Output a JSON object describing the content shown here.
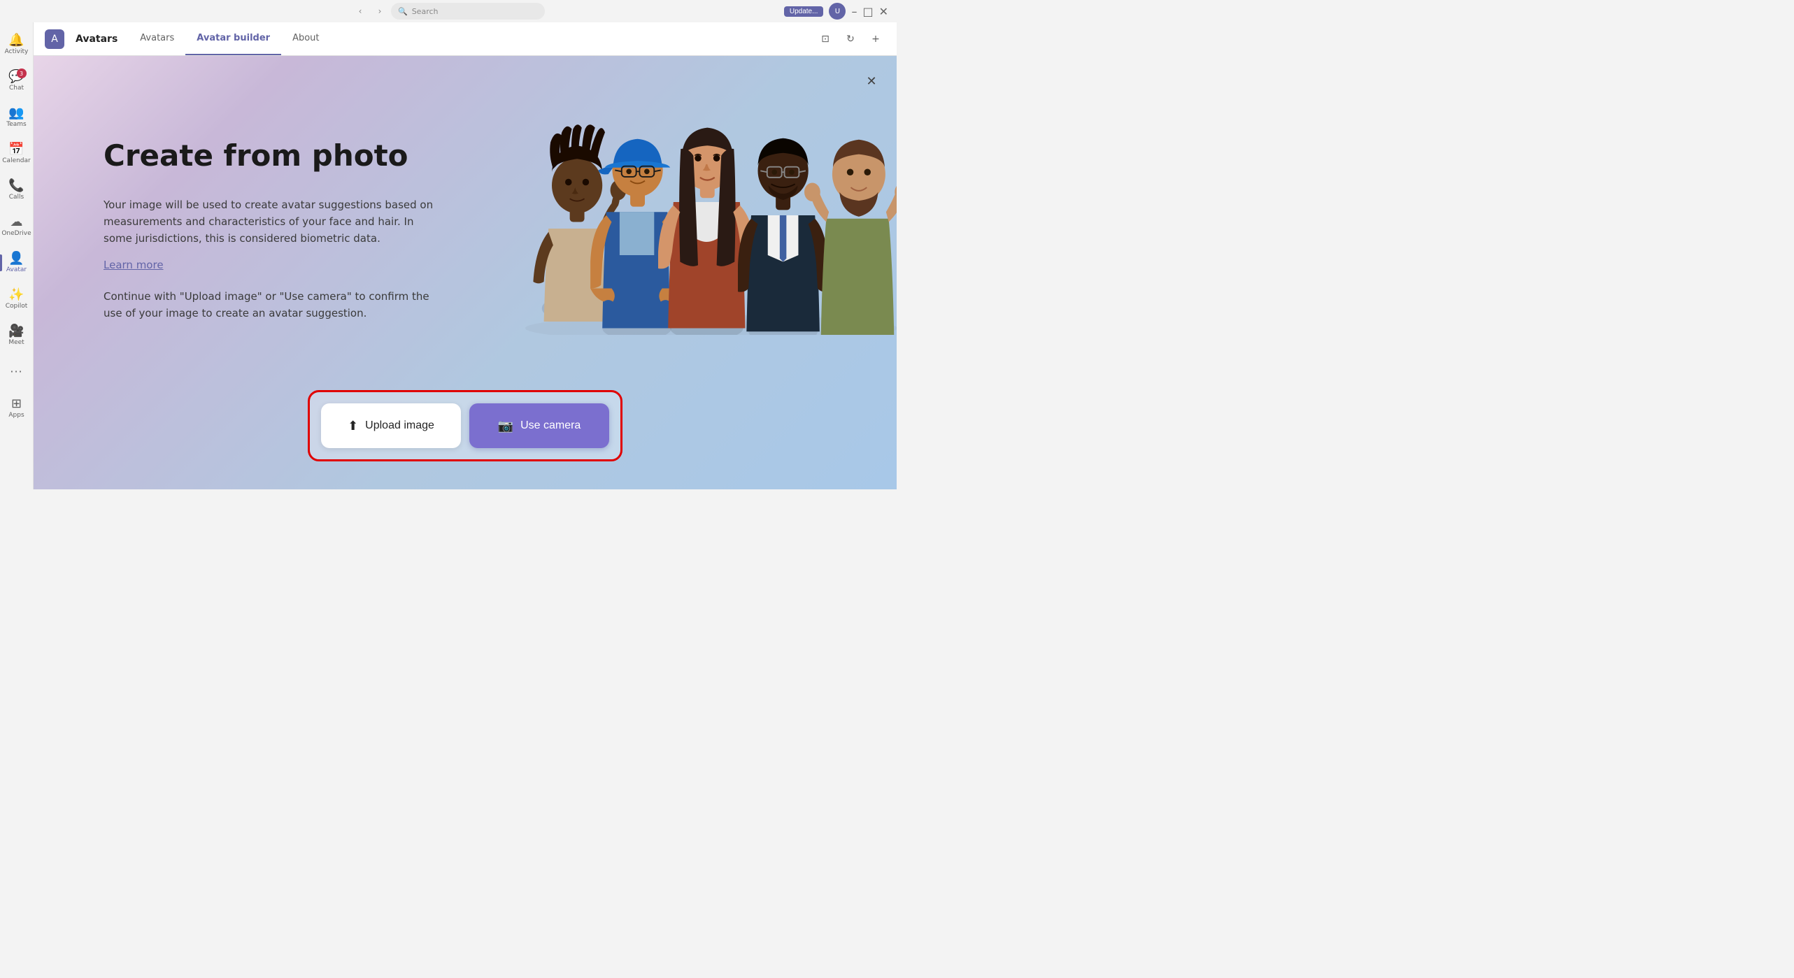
{
  "titlebar": {
    "search_placeholder": "Search",
    "update_label": "Update...",
    "nav_back": "‹",
    "nav_forward": "›"
  },
  "sidebar": {
    "items": [
      {
        "id": "activity",
        "label": "Activity",
        "icon": "🔔",
        "badge": null
      },
      {
        "id": "chat",
        "label": "Chat",
        "icon": "💬",
        "badge": "3"
      },
      {
        "id": "teams",
        "label": "Teams",
        "icon": "👥",
        "badge": null
      },
      {
        "id": "calendar",
        "label": "Calendar",
        "icon": "📅",
        "badge": null
      },
      {
        "id": "calls",
        "label": "Calls",
        "icon": "📞",
        "badge": null
      },
      {
        "id": "onedrive",
        "label": "OneDrive",
        "icon": "☁",
        "badge": null
      },
      {
        "id": "avatar",
        "label": "Avatar",
        "icon": "👤",
        "badge": null,
        "active": true
      },
      {
        "id": "copilot",
        "label": "Copilot",
        "icon": "✨",
        "badge": null
      },
      {
        "id": "meet",
        "label": "Meet",
        "icon": "🎥",
        "badge": null
      },
      {
        "id": "more",
        "label": "...",
        "icon": "···",
        "badge": null
      },
      {
        "id": "apps",
        "label": "Apps",
        "icon": "⊞",
        "badge": null
      }
    ]
  },
  "header": {
    "app_name": "Avatars",
    "logo_text": "A",
    "tabs": [
      {
        "id": "avatars",
        "label": "Avatars",
        "active": false
      },
      {
        "id": "avatar_builder",
        "label": "Avatar builder",
        "active": true
      },
      {
        "id": "about",
        "label": "About",
        "active": false
      }
    ],
    "icons": [
      "⊡",
      "↻",
      "+"
    ]
  },
  "modal": {
    "close_label": "✕",
    "heading": "Create from photo",
    "description": "Your image will be used to create avatar suggestions based on measurements and characteristics of your face and hair. In some jurisdictions, this is considered biometric data.",
    "learn_more_label": "Learn more",
    "confirm_text": "Continue with \"Upload image\" or \"Use camera\" to confirm the use of your image to create an avatar suggestion.",
    "buttons": {
      "upload_label": "Upload image",
      "camera_label": "Use camera",
      "upload_icon": "⬆",
      "camera_icon": "📷"
    }
  },
  "colors": {
    "accent": "#6264a7",
    "button_camera_bg": "#7b6fcf",
    "border_highlight": "#e00000"
  }
}
